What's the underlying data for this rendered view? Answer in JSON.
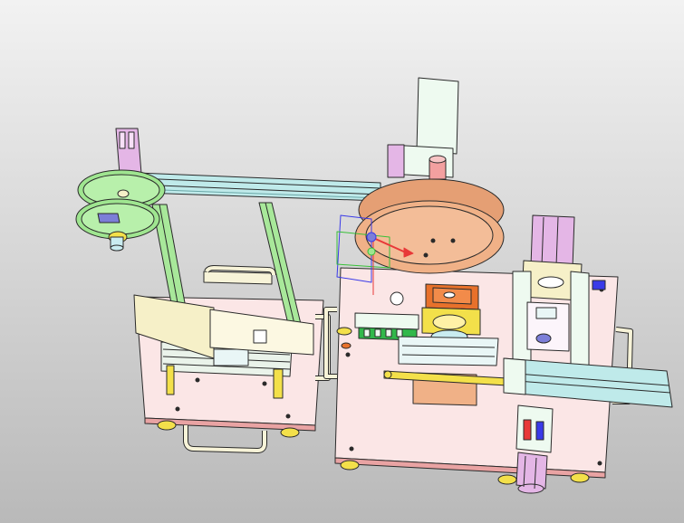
{
  "scene": {
    "kind": "cad-assembly-render",
    "colors": {
      "background_top": "#f2f2f2",
      "background_bottom": "#b9b9b9",
      "base_plate": "#fbe6e6",
      "base_plate_edge": "#d98d8d",
      "green_frame": "#a8e89a",
      "green_wheel": "#9fe590",
      "copper_disc": "#f0b187",
      "rail_cyan": "#bfeaea",
      "motor_lilac": "#e4b6e6",
      "pale_mint": "#eefaf0",
      "cream_tray": "#f6f0c8",
      "pcb_green": "#31b84b",
      "orange_block": "#e8712b",
      "yellow_gear": "#f3e04a",
      "handle_cream": "#f7f3d8",
      "outline": "#2a2a2a"
    },
    "icons": [
      "triad-axis-icon",
      "rotate-gizmo-icon"
    ]
  }
}
